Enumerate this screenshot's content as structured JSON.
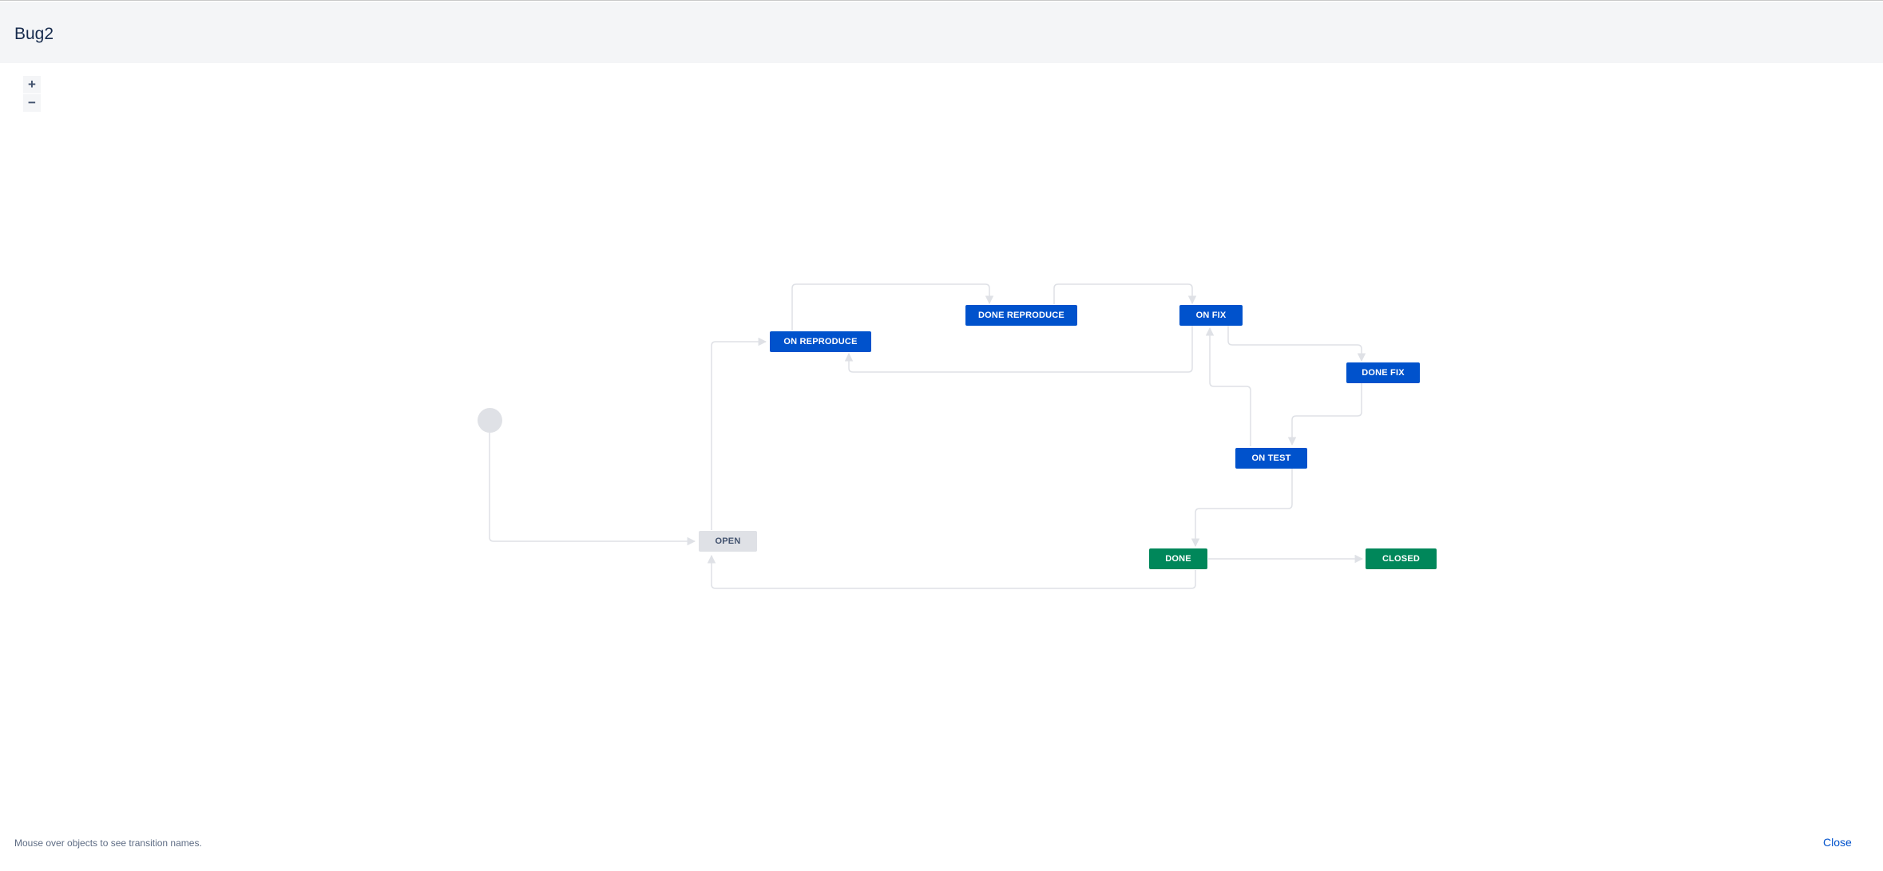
{
  "header": {
    "title": "Bug2"
  },
  "zoom": {
    "in_label": "+",
    "out_label": "−"
  },
  "workflow": {
    "statuses": [
      {
        "label": "OPEN",
        "category": "todo"
      },
      {
        "label": "ON REPRODUCE",
        "category": "in-progress"
      },
      {
        "label": "DONE REPRODUCE",
        "category": "in-progress"
      },
      {
        "label": "ON FIX",
        "category": "in-progress"
      },
      {
        "label": "DONE FIX",
        "category": "in-progress"
      },
      {
        "label": "ON TEST",
        "category": "in-progress"
      },
      {
        "label": "DONE",
        "category": "done"
      },
      {
        "label": "CLOSED",
        "category": "done"
      }
    ],
    "colors": {
      "todo": "#dfe1e6",
      "in_progress": "#0052cc",
      "done": "#00875a",
      "connector": "#dfe1e6"
    }
  },
  "footer": {
    "hint": "Mouse over objects to see transition names.",
    "close_label": "Close"
  }
}
